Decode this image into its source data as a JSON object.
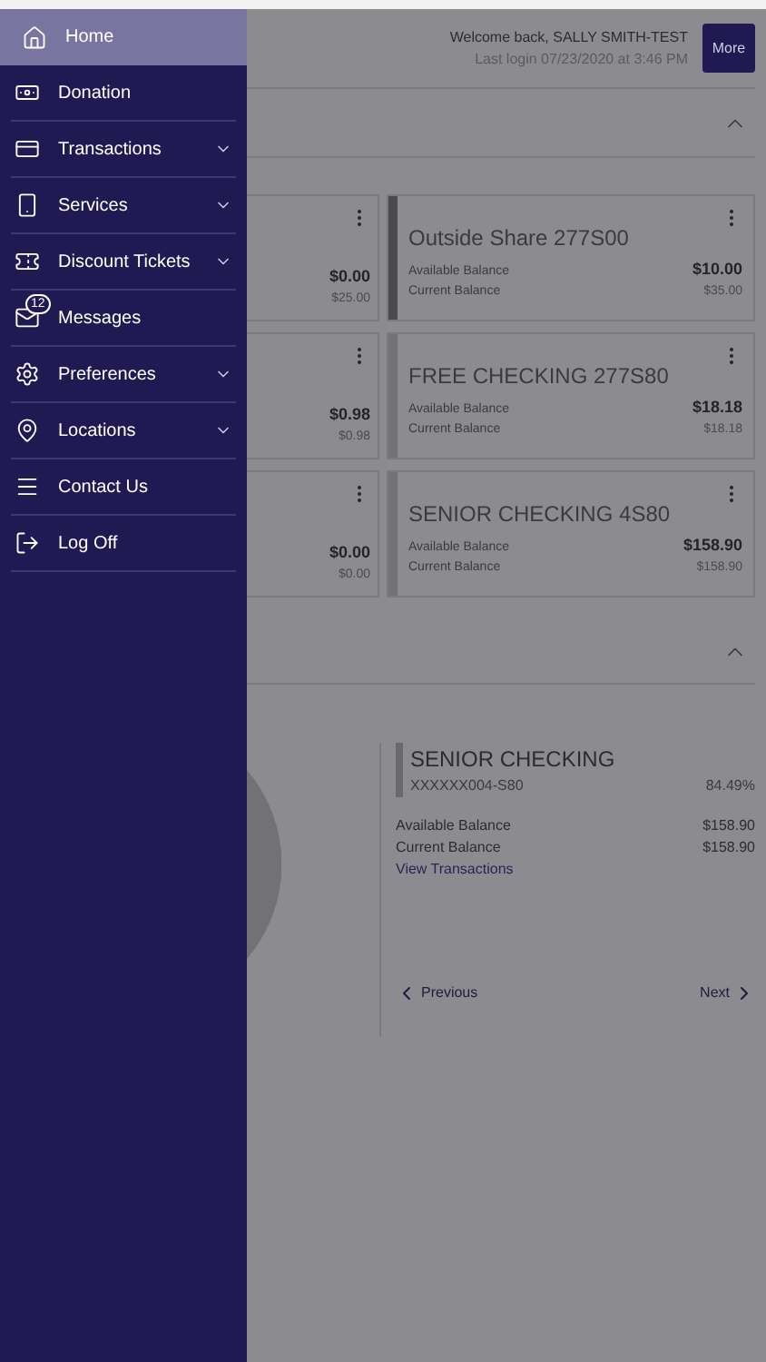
{
  "drawer": {
    "items": [
      {
        "label": "Home",
        "selected": true,
        "has_submenu": false
      },
      {
        "label": "Donation",
        "selected": false,
        "has_submenu": false
      },
      {
        "label": "Transactions",
        "selected": false,
        "has_submenu": true
      },
      {
        "label": "Services",
        "selected": false,
        "has_submenu": true
      },
      {
        "label": "Discount Tickets",
        "selected": false,
        "has_submenu": true
      },
      {
        "label": "Messages",
        "selected": false,
        "has_submenu": false,
        "badge": "12"
      },
      {
        "label": "Preferences",
        "selected": false,
        "has_submenu": true
      },
      {
        "label": "Locations",
        "selected": false,
        "has_submenu": true
      },
      {
        "label": "Contact Us",
        "selected": false,
        "has_submenu": false
      },
      {
        "label": "Log Off",
        "selected": false,
        "has_submenu": false
      }
    ]
  },
  "header": {
    "welcome": "Welcome back, SALLY SMITH-TEST",
    "last_login": "Last login 07/23/2020 at 3:46 PM",
    "more_button": "More"
  },
  "accounts": {
    "expanded": true,
    "rows": [
      {
        "left": {
          "available": "$0.00",
          "current": "$25.00"
        },
        "right": {
          "name": "Outside Share 277S00",
          "selected": true,
          "available_label": "Available Balance",
          "available": "$10.00",
          "current_label": "Current Balance",
          "current": "$35.00"
        }
      },
      {
        "left": {
          "available": "$0.98",
          "current": "$0.98"
        },
        "right": {
          "name": "FREE CHECKING 277S80",
          "selected": false,
          "available_label": "Available Balance",
          "available": "$18.18",
          "current_label": "Current Balance",
          "current": "$18.18"
        }
      },
      {
        "left": {
          "available": "$0.00",
          "current": "$0.00"
        },
        "right": {
          "name": "SENIOR CHECKING 4S80",
          "selected": false,
          "available_label": "Available Balance",
          "available": "$158.90",
          "current_label": "Current Balance",
          "current": "$158.90"
        }
      }
    ]
  },
  "summary": {
    "expanded": true,
    "detail": {
      "name": "SENIOR CHECKING",
      "account": "XXXXXX004-S80",
      "percent": "84.49%",
      "rows": [
        {
          "label": "Available Balance",
          "value": "$158.90"
        },
        {
          "label": "Current Balance",
          "value": "$158.90"
        }
      ],
      "link": "View Transactions",
      "previous": "Previous",
      "next": "Next"
    }
  }
}
